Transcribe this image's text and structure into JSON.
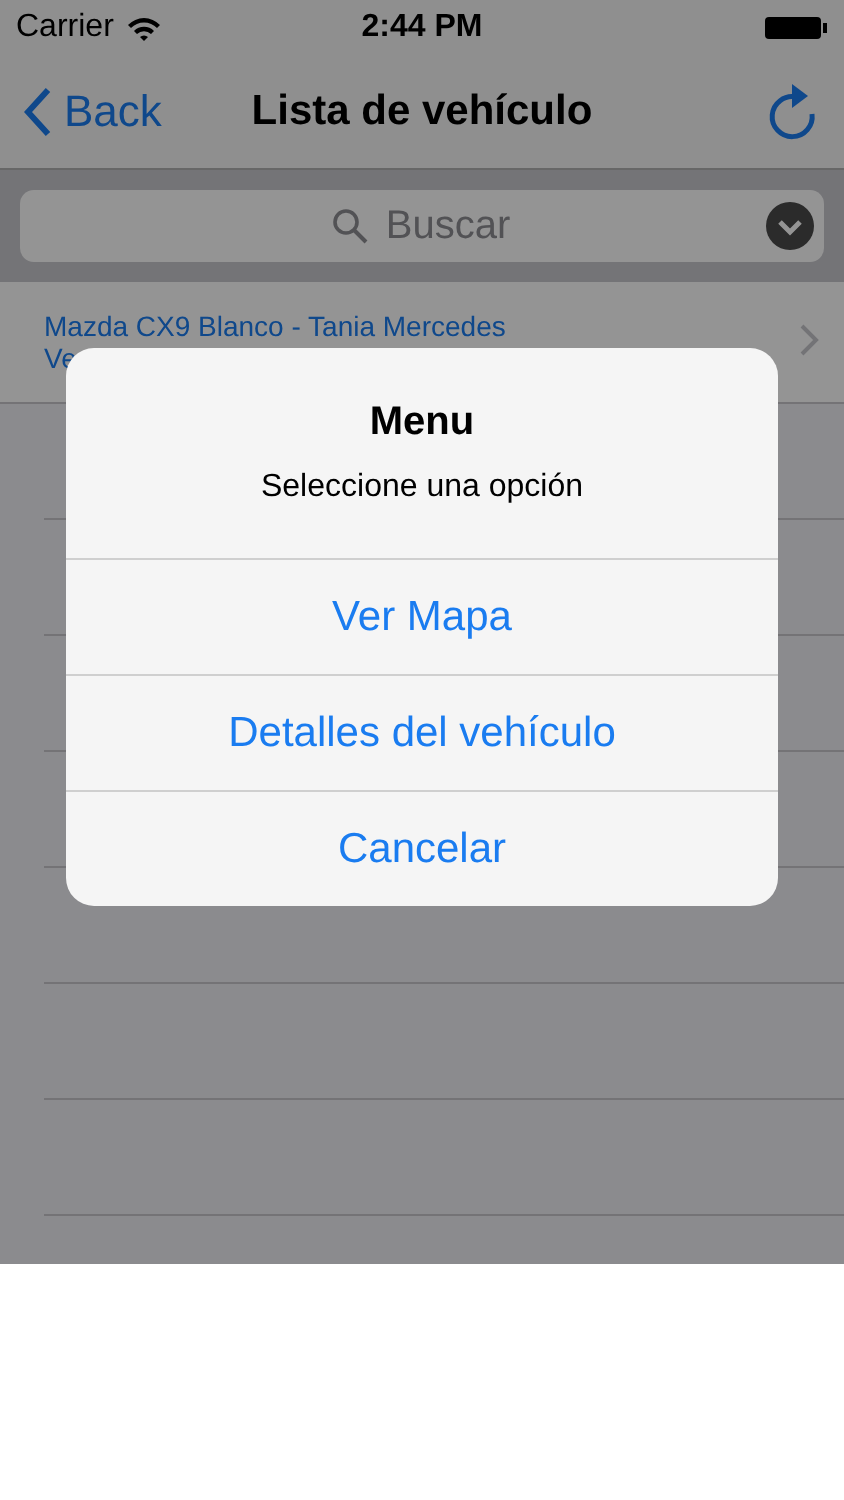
{
  "status_bar": {
    "carrier": "Carrier",
    "time": "2:44 PM"
  },
  "nav": {
    "back": "Back",
    "title": "Lista de vehículo"
  },
  "search": {
    "placeholder": "Buscar"
  },
  "rows": [
    {
      "line1": "Mazda CX9 Blanco - Tania Mercedes",
      "line2": "Ve"
    }
  ],
  "alert": {
    "title": "Menu",
    "message": "Seleccione una opción",
    "buttons": [
      "Ver Mapa",
      "Detalles del vehículo",
      "Cancelar"
    ]
  }
}
